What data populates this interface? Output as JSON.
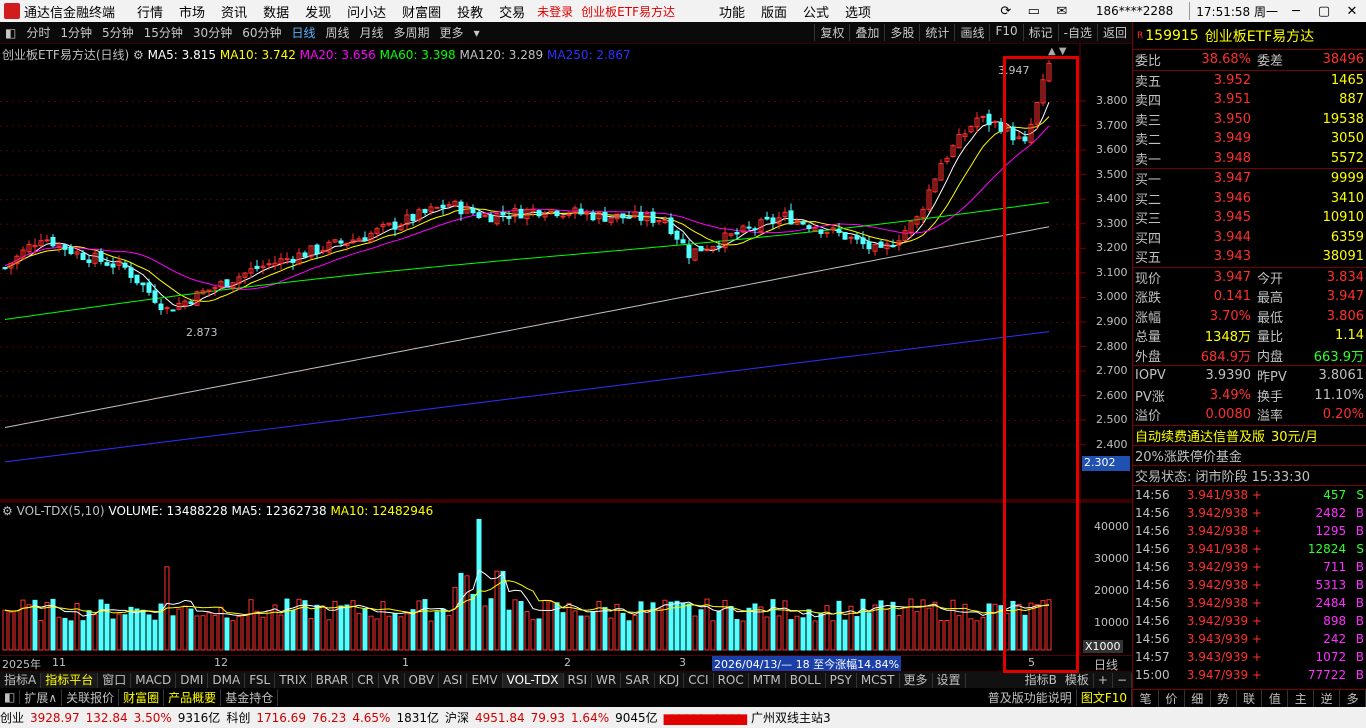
{
  "titlebar": {
    "app": "通达信金融终端",
    "menus": [
      "行情",
      "市场",
      "资讯",
      "数据",
      "发现",
      "问小达",
      "财富圈",
      "投教",
      "交易"
    ],
    "login": "未登录",
    "stock": "创业板ETF易方达",
    "menus2": [
      "功能",
      "版面",
      "公式",
      "选项"
    ],
    "account": "186****2288",
    "time": "17:51:58 周一",
    "win_min": "─",
    "win_max": "▢",
    "win_close": "✕"
  },
  "toolbar": {
    "periods": [
      "分时",
      "1分钟",
      "5分钟",
      "15分钟",
      "30分钟",
      "60分钟",
      "日线",
      "周线",
      "月线",
      "多周期",
      "更多"
    ],
    "right": [
      "复权",
      "叠加",
      "多股",
      "统计",
      "画线",
      "F10",
      "标记",
      "-自选",
      "返回"
    ]
  },
  "chart_title": {
    "name": "创业板ETF易方达(日线)",
    "ma5": "MA5: 3.815",
    "ma10": "MA10: 3.742",
    "ma20": "MA20: 3.656",
    "ma60": "MA60: 3.398",
    "ma120": "MA120: 3.289",
    "ma250": "MA250: 2.867"
  },
  "vol_title": {
    "name": "VOL-TDX(5,10)",
    "volume": "VOLUME: 13488228",
    "ma5": "MA5: 12362738",
    "ma10": "MA10: 12482946"
  },
  "price_axis": [
    "3.800",
    "3.700",
    "3.600",
    "3.500",
    "3.400",
    "3.300",
    "3.200",
    "3.100",
    "3.000",
    "2.900",
    "2.800",
    "2.700",
    "2.600",
    "2.500",
    "2.400"
  ],
  "price_axis_current": "2.302",
  "vol_axis": [
    "40000",
    "30000",
    "20000",
    "10000"
  ],
  "vol_unit": "X1000",
  "annot_high": "3.947",
  "annot_low": "2.873",
  "datebar": {
    "labels": [
      "2025年",
      "11",
      "12",
      "1",
      "2",
      "3",
      "5"
    ],
    "highlight": "2026/04/13/— 18 至今涨幅14.84%",
    "right": "日线"
  },
  "tabs": [
    "指标A",
    "指标平台",
    "窗口",
    "MACD",
    "DMI",
    "DMA",
    "FSL",
    "TRIX",
    "BRAR",
    "CR",
    "VR",
    "OBV",
    "ASI",
    "EMV",
    "VOL-TDX",
    "RSI",
    "WR",
    "SAR",
    "KDJ",
    "CCI",
    "ROC",
    "MTM",
    "BOLL",
    "PSY",
    "MCST",
    "更多",
    "设置"
  ],
  "tabs2": [
    "扩展∧",
    "关联报价",
    "财富圈",
    "产品概要",
    "基金持仓"
  ],
  "tabs2_right": [
    "普及版功能说明",
    "图文F10"
  ],
  "right_tabs": [
    "指标B",
    "模板",
    "+",
    "−"
  ],
  "quote": {
    "code": "159915",
    "name": "创业板ETF易方达",
    "weibi_l": "委比",
    "weibi": "38.68%",
    "weicha_l": "委差",
    "weicha": "38496",
    "sells": [
      [
        "卖五",
        "3.952",
        "1465"
      ],
      [
        "卖四",
        "3.951",
        "887"
      ],
      [
        "卖三",
        "3.950",
        "19538"
      ],
      [
        "卖二",
        "3.949",
        "3050"
      ],
      [
        "卖一",
        "3.948",
        "5572"
      ]
    ],
    "buys": [
      [
        "买一",
        "3.947",
        "9999"
      ],
      [
        "买二",
        "3.946",
        "3410"
      ],
      [
        "买三",
        "3.945",
        "10910"
      ],
      [
        "买四",
        "3.944",
        "6359"
      ],
      [
        "买五",
        "3.943",
        "38091"
      ]
    ],
    "stats": [
      [
        "现价",
        "3.947",
        "今开",
        "3.834"
      ],
      [
        "涨跌",
        "0.141",
        "最高",
        "3.947"
      ],
      [
        "涨幅",
        "3.70%",
        "最低",
        "3.806"
      ],
      [
        "总量",
        "1348万",
        "量比",
        "1.14"
      ],
      [
        "外盘",
        "684.9万",
        "内盘",
        "663.9万"
      ]
    ],
    "stats2": [
      [
        "IOPV",
        "3.9390",
        "昨PV",
        "3.8061"
      ],
      [
        "PV涨",
        "3.49%",
        "换手",
        "11.10%"
      ],
      [
        "溢价",
        "0.0080",
        "溢率",
        "0.20%"
      ]
    ],
    "promo": "自动续费通达信普及版",
    "promo_price": "30元/月",
    "tag": "20%涨跌停价基金",
    "status": "交易状态: 闭市阶段 15:33:30"
  },
  "ticks": [
    [
      "14:56",
      "3.941/938",
      "+",
      "457",
      "S"
    ],
    [
      "14:56",
      "3.942/938",
      "+",
      "2482",
      "B"
    ],
    [
      "14:56",
      "3.942/938",
      "+",
      "1295",
      "B"
    ],
    [
      "14:56",
      "3.941/938",
      "+",
      "12824",
      "S"
    ],
    [
      "14:56",
      "3.942/939",
      "+",
      "711",
      "B"
    ],
    [
      "14:56",
      "3.942/938",
      "+",
      "5313",
      "B"
    ],
    [
      "14:56",
      "3.942/938",
      "+",
      "2484",
      "B"
    ],
    [
      "14:56",
      "3.942/939",
      "+",
      "898",
      "B"
    ],
    [
      "14:56",
      "3.943/939",
      "+",
      "242",
      "B"
    ],
    [
      "14:57",
      "3.943/939",
      "+",
      "1072",
      "B"
    ],
    [
      "15:00",
      "3.947/939",
      "+",
      "77722",
      "B"
    ]
  ],
  "right_bottom": [
    "笔",
    "价",
    "细",
    "势",
    "联",
    "值",
    "主",
    "逆",
    "多"
  ],
  "statusbar": {
    "cy_l": "创业",
    "cy": "3928.97",
    "cy_c": "132.84",
    "cy_p": "3.50%",
    "cy_v": "9316亿",
    "kc_l": "科创",
    "kc": "1716.69",
    "kc_c": "76.23",
    "kc_p": "4.65%",
    "kc_v": "1831亿",
    "hs_l": "沪深",
    "hs": "4951.84",
    "hs_c": "79.93",
    "hs_p": "1.64%",
    "hs_v": "9045亿",
    "server": "广州双线主站3"
  },
  "colors": {
    "up": "#ff3030",
    "down": "#54ffff",
    "ma5": "#ffffff",
    "ma10": "#ffff00",
    "ma20": "#ff00ff",
    "ma60": "#00ff00",
    "ma120": "#c0c0c0",
    "ma250": "#3030ff"
  },
  "chart_data": {
    "type": "candlestick",
    "ylim": [
      2.3,
      3.96
    ],
    "last_close": 3.947,
    "high": 3.947,
    "low": 2.873
  }
}
